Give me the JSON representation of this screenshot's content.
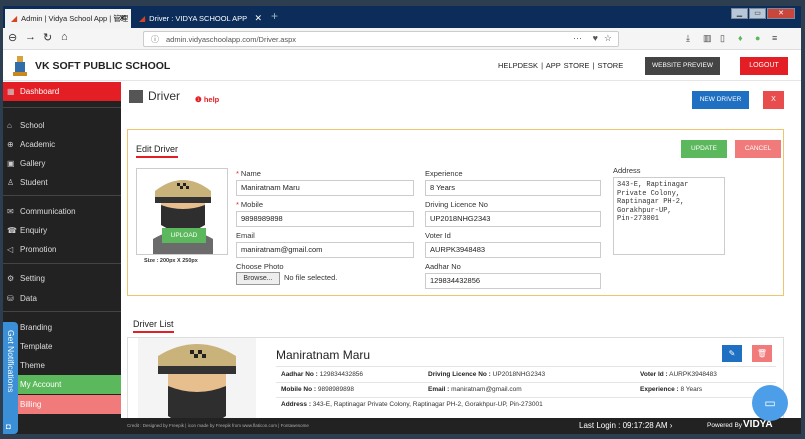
{
  "browser": {
    "tabs": [
      {
        "label": "Admin | Vidya School App | 管理",
        "close": "✕"
      },
      {
        "label": "Driver : VIDYA SCHOOL APP",
        "close": "✕"
      }
    ],
    "new_tab": "+",
    "url": "admin.vidyaschoolapp.com/Driver.aspx",
    "url_dots": "···"
  },
  "header": {
    "school_name": "VK SOFT PUBLIC SCHOOL",
    "links": "HELPDESK | APP STORE | STORE",
    "website_preview": "WEBSITE PREVIEW",
    "logout": "LOGOUT"
  },
  "sidebar": {
    "items": [
      {
        "label": "Dashboard",
        "icon": "dashboard-icon"
      },
      {
        "label": "School",
        "icon": "school-icon"
      },
      {
        "label": "Academic",
        "icon": "academic-icon"
      },
      {
        "label": "Gallery",
        "icon": "gallery-icon"
      },
      {
        "label": "Student",
        "icon": "student-icon"
      },
      {
        "label": "Communication",
        "icon": "communication-icon"
      },
      {
        "label": "Enquiry",
        "icon": "enquiry-icon"
      },
      {
        "label": "Promotion",
        "icon": "promotion-icon"
      },
      {
        "label": "Setting",
        "icon": "setting-icon"
      },
      {
        "label": "Data",
        "icon": "data-icon"
      },
      {
        "label": "Branding",
        "icon": "branding-icon"
      },
      {
        "label": "Template",
        "icon": "template-icon"
      },
      {
        "label": "Theme",
        "icon": "theme-icon"
      },
      {
        "label": "My Account",
        "icon": "account-icon"
      },
      {
        "label": "Billing",
        "icon": "billing-icon"
      }
    ],
    "notifications": "Get Notifications"
  },
  "page": {
    "title": "Driver",
    "help": "help",
    "new_driver": "NEW DRIVER",
    "close": "X"
  },
  "edit": {
    "section_title": "Edit Driver",
    "update": "UPDATE",
    "cancel": "CANCEL",
    "upload": "UPLOAD",
    "size_hint": "Size : 200px X 250px",
    "name_label": "Name",
    "name_value": "Maniratnam Maru",
    "mobile_label": "Mobile",
    "mobile_value": "9898989898",
    "email_label": "Email",
    "email_value": "maniratnam@gmail.com",
    "photo_label": "Choose Photo",
    "browse": "Browse...",
    "no_file": "No file selected.",
    "experience_label": "Experience",
    "experience_value": "8 Years",
    "licence_label": "Driving Licence No",
    "licence_value": "UP2018NHG2343",
    "voter_label": "Voter Id",
    "voter_value": "AURPK3948483",
    "aadhar_label": "Aadhar No",
    "aadhar_value": "129834432856",
    "address_label": "Address",
    "address_value": "343-E, Raptinagar\nPrivate Colony,\nRaptinagar PH-2,\nGorakhpur-UP,\nPin-273001"
  },
  "list": {
    "section_title": "Driver List",
    "driver": {
      "name": "Maniratnam Maru",
      "aadhar_label": "Aadhar No :",
      "aadhar": "129834432856",
      "licence_label": "Driving Licence No :",
      "licence": "UP2018NHG2343",
      "voter_label": "Voter Id :",
      "voter": "AURPK3948483",
      "mobile_label": "Mobile No :",
      "mobile": "9898989898",
      "email_label": "Email :",
      "email": "maniratnam@gmail.com",
      "experience_label": "Experience :",
      "experience": "8 Years",
      "address_label": "Address :",
      "address": "343-E, Raptinagar Private Colony, Raptinagar PH-2, Gorakhpur-UP, Pin-273001"
    }
  },
  "footer": {
    "credit": "Credit : Designed by Freepik | icon made by Freepik from www.flaticon.com | Fontawesome",
    "last_login": "Last Login : 09:17:28 AM",
    "powered": "Powered By",
    "brand": "VIDYA"
  },
  "colors": {
    "accent": "#e31e24",
    "primary": "#1f6fc2",
    "success": "#5cb85c",
    "danger_light": "#f17a7a"
  }
}
